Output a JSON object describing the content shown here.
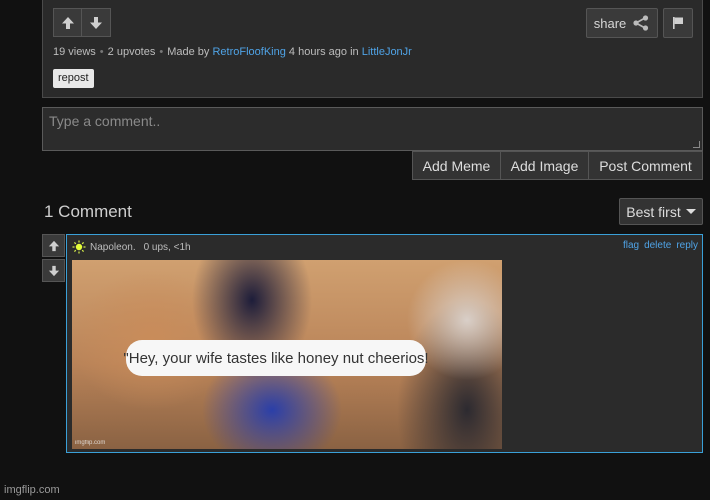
{
  "post": {
    "views": "19 views",
    "upvotes": "2 upvotes",
    "made_by_prefix": "Made by",
    "author": "RetroFloofKing",
    "time_in": "4 hours ago in",
    "stream": "LittleJonJr",
    "tag": "repost",
    "share_label": "share"
  },
  "comment_form": {
    "placeholder": "Type a comment..",
    "add_meme": "Add Meme",
    "add_image": "Add Image",
    "post_comment": "Post Comment"
  },
  "comments": {
    "count_label": "1 Comment",
    "sort_label": "Best first",
    "items": [
      {
        "user": "Napoleon.",
        "meta": "0 ups, <1h",
        "actions": {
          "flag": "flag",
          "delete": "delete",
          "reply": "reply"
        },
        "meme_caption": "\"Hey, your wife tastes like honey nut cheerios!",
        "meme_watermark": "imgflip.com"
      }
    ]
  },
  "footer": {
    "watermark": "imgflip.com"
  },
  "colors": {
    "accent": "#3aa0d8",
    "link": "#4fa3e6",
    "background": "#111111"
  }
}
